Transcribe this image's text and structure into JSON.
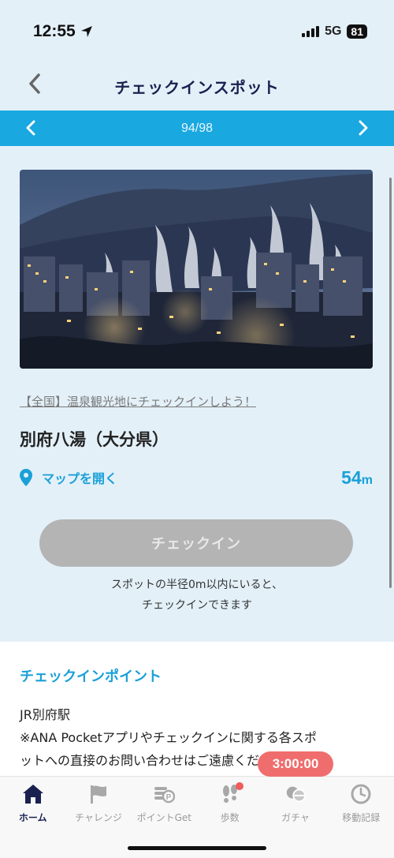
{
  "status_bar": {
    "time": "12:55",
    "network": "5G",
    "battery": "81"
  },
  "header": {
    "title": "チェックインスポット"
  },
  "pager": {
    "text": "94/98"
  },
  "spot": {
    "campaign_link": "【全国】温泉観光地にチェックインしよう！",
    "name": "別府八湯（大分県）",
    "map_label": "マップを開く",
    "distance_value": "54",
    "distance_unit": "m",
    "checkin_label": "チェックイン",
    "note_line1": "スポットの半径0m以内にいると、",
    "note_line2": "チェックインできます"
  },
  "points": {
    "title": "チェックインポイント",
    "line1": "JR別府駅",
    "line2": "※ANA Pocketアプリやチェックインに関する各スポ",
    "line3": "ットへの直接のお問い合わせはご遠慮ください"
  },
  "timer": {
    "text": "3:00:00"
  },
  "tabs": [
    {
      "label": "ホーム",
      "icon": "home-icon",
      "active": true
    },
    {
      "label": "チャレンジ",
      "icon": "flag-icon"
    },
    {
      "label": "ポイントGet",
      "icon": "points-icon"
    },
    {
      "label": "歩数",
      "icon": "footprints-icon"
    },
    {
      "label": "ガチャ",
      "icon": "gacha-icon"
    },
    {
      "label": "移動記録",
      "icon": "clock-icon"
    }
  ],
  "colors": {
    "accent": "#1aa8e0",
    "navy": "#1a2150",
    "background": "#e3f0f8",
    "timer": "#f06d6d",
    "disabled": "#b4b4b4"
  }
}
